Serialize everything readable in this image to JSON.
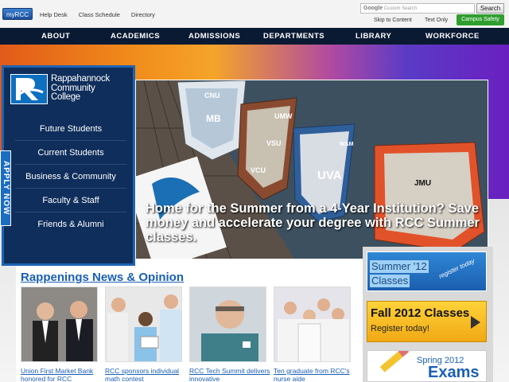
{
  "topbar": {
    "myrcc_label": "myRCC",
    "links": [
      "Help Desk",
      "Class Schedule",
      "Directory"
    ],
    "search_brand": "Google",
    "search_placeholder": "Custom Search",
    "search_button": "Search",
    "skip_label": "Skip to Content",
    "text_only_label": "Text Only",
    "safety_label": "Campus Safety"
  },
  "nav": {
    "items": [
      "ABOUT",
      "ACADEMICS",
      "ADMISSIONS",
      "DEPARTMENTS",
      "LIBRARY",
      "WORKFORCE"
    ]
  },
  "logo": {
    "line1": "Rappahannock",
    "line2": "Community",
    "line3": "College"
  },
  "sidebar": {
    "links": [
      "Future Students",
      "Current Students",
      "Business & Community",
      "Faculty & Staff",
      "Friends & Alumni"
    ],
    "apply_label": "APPLY NOW"
  },
  "hero": {
    "caption": "Home for the Summer from a 4-Year Institution? Save money and accelerate your degree with RCC Summer classes.",
    "boat_labels": [
      "CNU",
      "MB",
      "UMW",
      "VSU",
      "VCU",
      "W&M",
      "UVA",
      "JMU"
    ]
  },
  "news": {
    "title": "Rappenings News & Opinion",
    "items": [
      {
        "caption": "Union First Market Bank honored for RCC"
      },
      {
        "caption": "RCC sponsors individual math contest"
      },
      {
        "caption": "RCC Tech Summit delivers innovative"
      },
      {
        "caption": "Ten graduate from RCC's nurse aide"
      }
    ]
  },
  "promos": {
    "summer_line1": "Summer '12",
    "summer_line2": "Classes",
    "summer_sub": "register today",
    "fall_title": "Fall 2012 Classes",
    "fall_sub": "Register today!",
    "spring_title": "Spring 2012",
    "spring_sub": "Exams"
  },
  "colors": {
    "nav_bg": "#0b1a33",
    "link_blue": "#1a5fb4",
    "safety_green": "#2f9e2f",
    "panel_bg": "#0f2e5b"
  }
}
